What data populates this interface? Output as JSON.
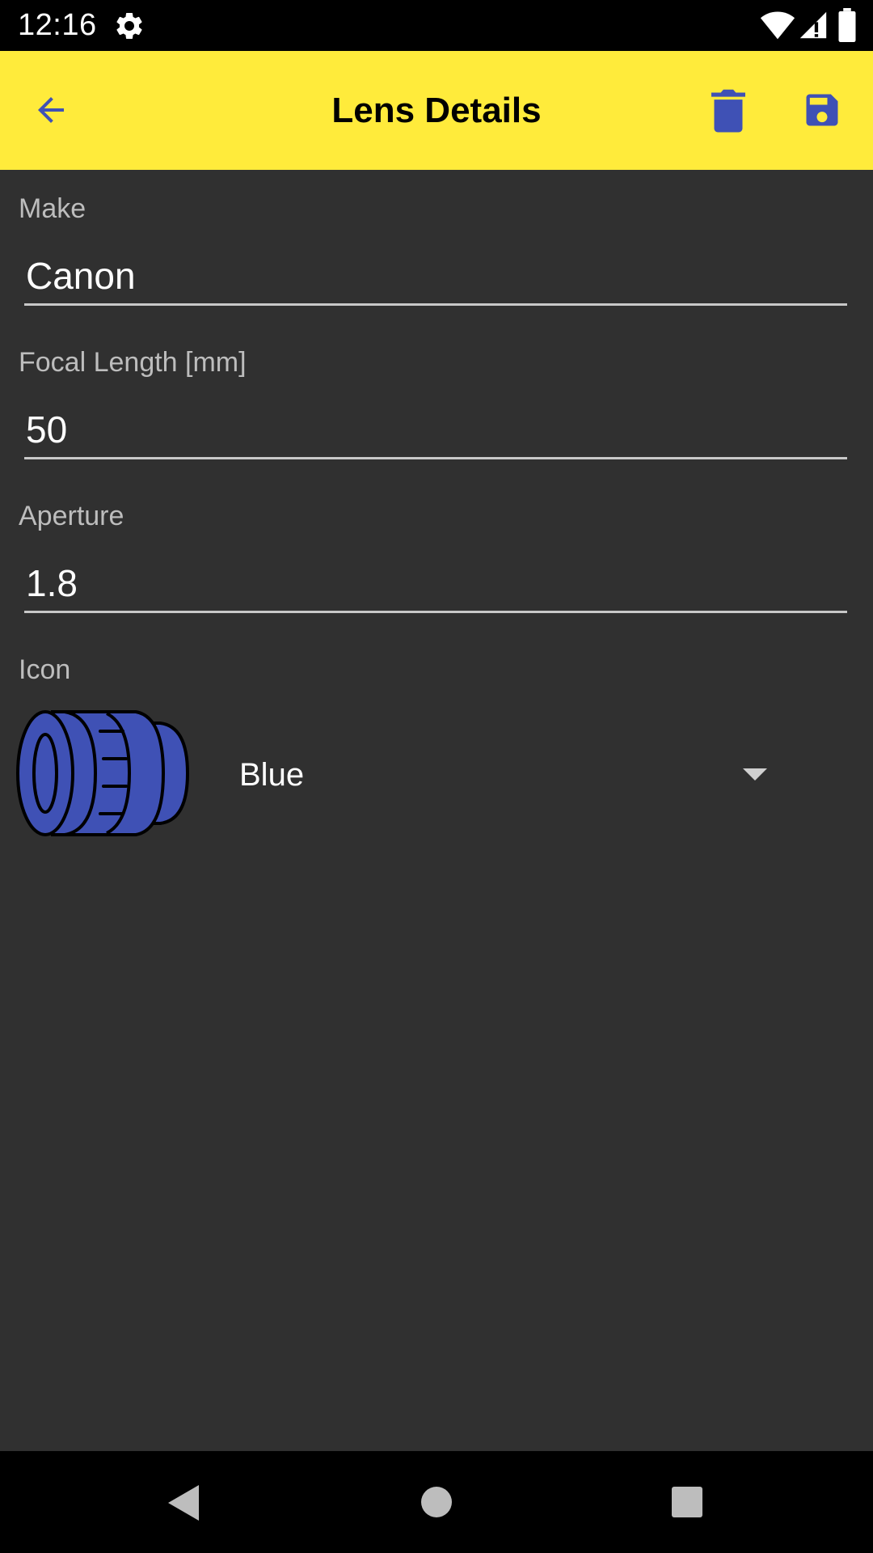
{
  "status_bar": {
    "time": "12:16"
  },
  "app_bar": {
    "title": "Lens Details",
    "icons": [
      "arrow-back-icon",
      "trash-icon",
      "save-icon"
    ],
    "accent_color": "#ffeb3b",
    "icon_color": "#3f51b5"
  },
  "form": {
    "make": {
      "label": "Make",
      "value": "Canon"
    },
    "focal_length": {
      "label": "Focal Length [mm]",
      "value": "50"
    },
    "aperture": {
      "label": "Aperture",
      "value": "1.8"
    },
    "icon": {
      "label": "Icon",
      "selected": "Blue",
      "icon_name": "lens-icon",
      "icon_color": "#3f51b5"
    }
  },
  "colors": {
    "background": "#303030",
    "label": "#bdbdbd",
    "text": "#ffffff"
  }
}
